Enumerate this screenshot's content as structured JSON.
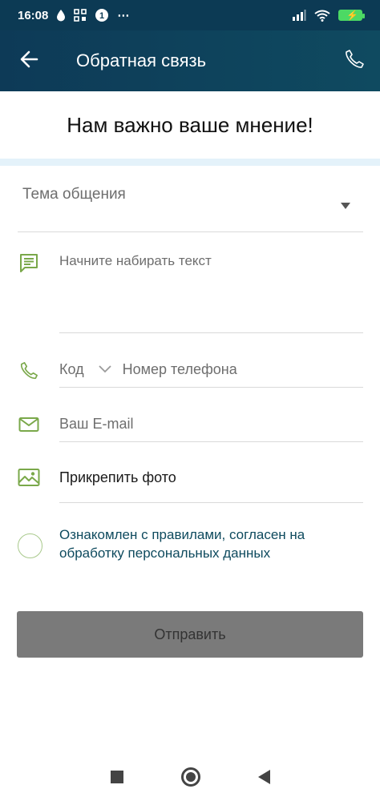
{
  "status_bar": {
    "time": "16:08",
    "icons": [
      "drop-icon",
      "grid-icon",
      "app-badge-icon",
      "more-icon",
      "signal-icon",
      "wifi-icon",
      "battery-charging-icon"
    ],
    "more": "⋯"
  },
  "app_bar": {
    "title": "Обратная связь",
    "back_icon": "arrow-left-icon",
    "call_icon": "phone-icon"
  },
  "headline": "Нам важно ваше мнение!",
  "form": {
    "topic_placeholder": "Тема общения",
    "message_placeholder": "Начните набирать текст",
    "phone_code_label": "Код",
    "phone_placeholder": "Номер телефона",
    "email_placeholder": "Ваш E-mail",
    "attach_label": "Прикрепить фото",
    "consent_text": "Ознакомлен с правилами, согласен на обработку персональных данных",
    "submit_label": "Отправить"
  },
  "colors": {
    "app_bar": "#0d3a57",
    "accent_green": "#7aa84a",
    "consent_text": "#0e4a5e",
    "submit_disabled": "#7a7a7a"
  }
}
